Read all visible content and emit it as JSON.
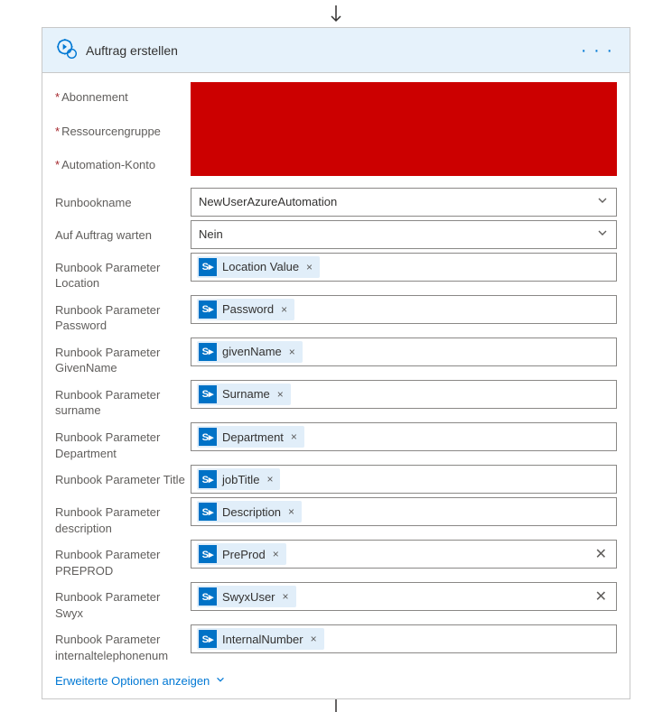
{
  "header": {
    "title": "Auftrag erstellen"
  },
  "fields": {
    "subscription": {
      "label": "Abonnement"
    },
    "resourceGroup": {
      "label": "Ressourcengruppe"
    },
    "automationAccount": {
      "label": "Automation-Konto"
    },
    "runbookName": {
      "label": "Runbookname",
      "value": "NewUserAzureAutomation"
    },
    "waitForJob": {
      "label": "Auf Auftrag warten",
      "value": "Nein"
    },
    "paramLocation": {
      "label": "Runbook Parameter Location",
      "token": "Location Value"
    },
    "paramPassword": {
      "label": "Runbook Parameter Password",
      "token": "Password"
    },
    "paramGivenName": {
      "label": "Runbook Parameter GivenName",
      "token": "givenName"
    },
    "paramSurname": {
      "label": "Runbook Parameter surname",
      "token": "Surname"
    },
    "paramDepartment": {
      "label": "Runbook Parameter Department",
      "token": "Department"
    },
    "paramTitle": {
      "label": "Runbook Parameter Title",
      "token": "jobTitle"
    },
    "paramDescription": {
      "label": "Runbook Parameter description",
      "token": "Description"
    },
    "paramPreprod": {
      "label": "Runbook Parameter PREPROD",
      "token": "PreProd",
      "clearable": true
    },
    "paramSwyx": {
      "label": "Runbook Parameter Swyx",
      "token": "SwyxUser",
      "clearable": true
    },
    "paramInternalTel": {
      "label": "Runbook Parameter internaltelephonenum",
      "token": "InternalNumber"
    }
  },
  "advancedOptions": "Erweiterte Optionen anzeigen"
}
